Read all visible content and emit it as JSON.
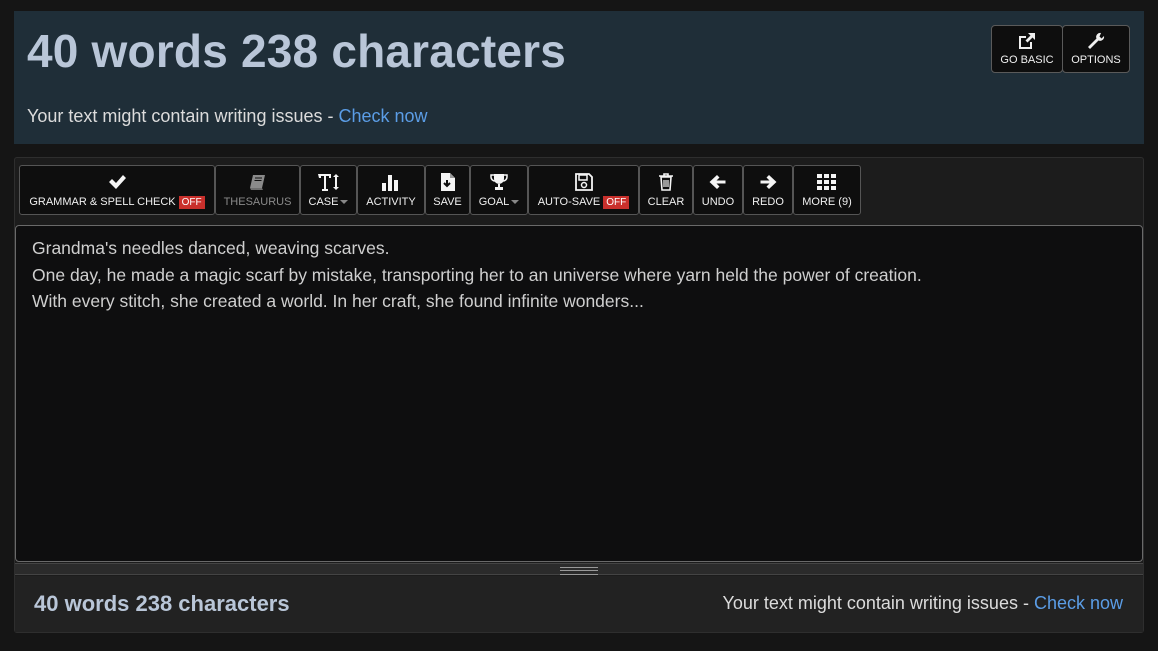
{
  "header": {
    "title": "40 words 238 characters",
    "issues_text": "Your text might contain writing issues - ",
    "check_now": "Check now",
    "buttons": [
      {
        "label": "GO BASIC",
        "icon": "external-link-icon"
      },
      {
        "label": "OPTIONS",
        "icon": "wrench-icon"
      }
    ]
  },
  "toolbar": {
    "grammar": {
      "label": "GRAMMAR & SPELL CHECK",
      "badge": "OFF",
      "icon": "check-icon"
    },
    "thesaurus": {
      "label": "THESAURUS",
      "icon": "book-icon"
    },
    "case": {
      "label": "CASE",
      "icon": "text-case-icon"
    },
    "activity": {
      "label": "ACTIVITY",
      "icon": "bar-chart-icon"
    },
    "save": {
      "label": "SAVE",
      "icon": "file-download-icon"
    },
    "goal": {
      "label": "GOAL",
      "icon": "trophy-icon"
    },
    "autosave": {
      "label": "AUTO-SAVE",
      "badge": "OFF",
      "icon": "floppy-icon"
    },
    "clear": {
      "label": "CLEAR",
      "icon": "trash-icon"
    },
    "undo": {
      "label": "UNDO",
      "icon": "arrow-left-icon"
    },
    "redo": {
      "label": "REDO",
      "icon": "arrow-right-icon"
    },
    "more": {
      "label": "MORE (9)",
      "icon": "grid-icon"
    }
  },
  "editor": {
    "lines": [
      "Grandma's needles danced, weaving scarves.",
      "One day, he made a magic scarf by mistake, transporting her to an universe where yarn held the power of creation.",
      "With every stitch, she created a world. In her craft, she found infinite wonders..."
    ]
  },
  "footer": {
    "count": "40 words 238 characters",
    "issues_text": "Your text might contain writing issues - ",
    "check_now": "Check now"
  },
  "colors": {
    "accent_link": "#5b9de6",
    "title": "#b9c6d8",
    "badge_off": "#c9302c",
    "header_bg": "#1f2e38"
  }
}
